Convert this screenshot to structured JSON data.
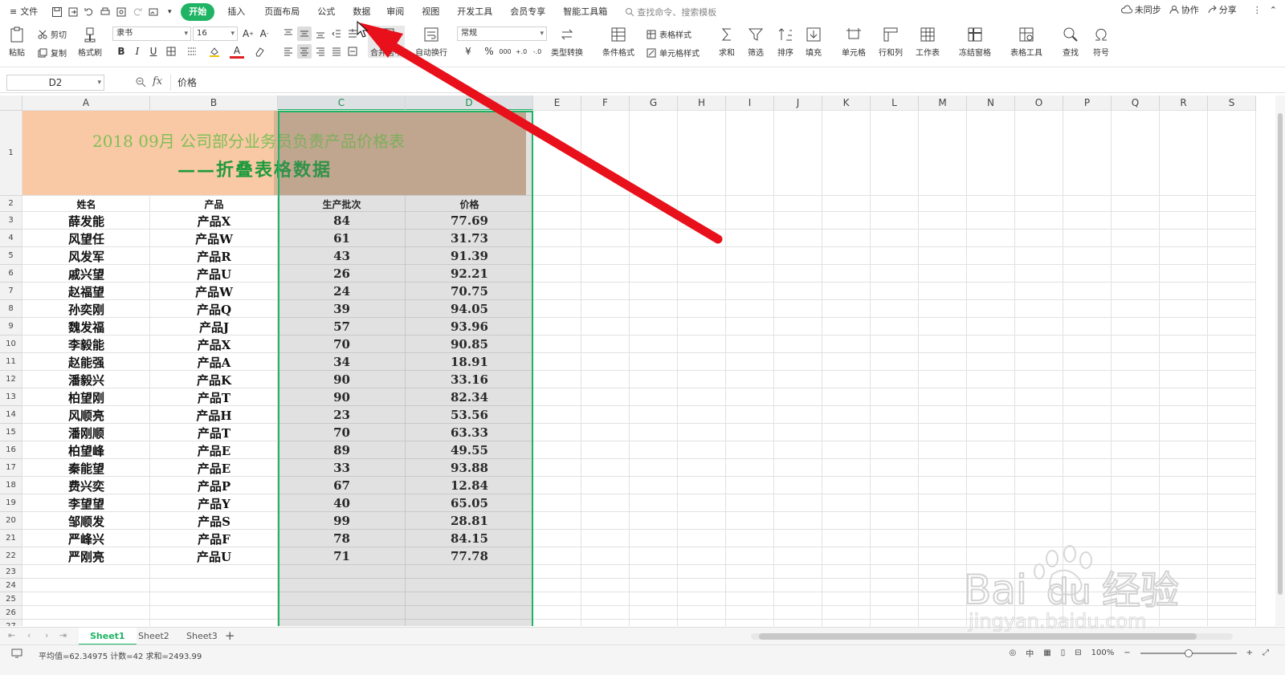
{
  "menu": {
    "file": "文件",
    "tabs": [
      "开始",
      "插入",
      "页面布局",
      "公式",
      "数据",
      "审阅",
      "视图",
      "开发工具",
      "会员专享",
      "智能工具箱"
    ],
    "active_tab": "开始",
    "search_placeholder": "查找命令、搜索模板",
    "sync": "未同步",
    "collab": "协作",
    "share": "分享"
  },
  "ribbon": {
    "paste": "粘贴",
    "cut": "剪切",
    "copy": "复制",
    "format_painter": "格式刷",
    "font_name": "隶书",
    "font_size": "16",
    "merge_center": "合并居中",
    "wrap_text": "自动换行",
    "number_format": "常规",
    "type_convert": "类型转换",
    "conditional_format": "条件格式",
    "table_style": "表格样式",
    "cell_style": "单元格样式",
    "sum": "求和",
    "filter": "筛选",
    "sort": "排序",
    "fill": "填充",
    "cell": "单元格",
    "row_col": "行和列",
    "worksheet": "工作表",
    "freeze": "冻结窗格",
    "table_tools": "表格工具",
    "find": "查找",
    "symbol": "符号"
  },
  "formula_bar": {
    "cell_ref": "D2",
    "fx": "fx",
    "content": "价格"
  },
  "grid": {
    "columns": [
      "A",
      "B",
      "C",
      "D",
      "E",
      "F",
      "G",
      "H",
      "I",
      "J",
      "K",
      "L",
      "M",
      "N",
      "O",
      "P",
      "Q",
      "R",
      "S"
    ],
    "selected_columns": [
      "C",
      "D"
    ],
    "rows": [
      "1",
      "2",
      "3",
      "4",
      "5",
      "6",
      "7",
      "8",
      "9",
      "10",
      "11",
      "12",
      "13",
      "14",
      "15",
      "16",
      "17",
      "18",
      "19",
      "20",
      "21",
      "22",
      "23",
      "24",
      "25",
      "26",
      "27"
    ],
    "title_line1": "2018 09月 公司部分业务员负责产品价格表",
    "title_line2": "——折叠表格数据",
    "headers": [
      "姓名",
      "产品",
      "生产批次",
      "价格"
    ],
    "data": [
      [
        "薛发能",
        "产品X",
        "84",
        "77.69"
      ],
      [
        "风望任",
        "产品W",
        "61",
        "31.73"
      ],
      [
        "风发军",
        "产品R",
        "43",
        "91.39"
      ],
      [
        "戚兴望",
        "产品U",
        "26",
        "92.21"
      ],
      [
        "赵福望",
        "产品W",
        "24",
        "70.75"
      ],
      [
        "孙奕刚",
        "产品Q",
        "39",
        "94.05"
      ],
      [
        "魏发福",
        "产品J",
        "57",
        "93.96"
      ],
      [
        "李毅能",
        "产品X",
        "70",
        "90.85"
      ],
      [
        "赵能强",
        "产品A",
        "34",
        "18.91"
      ],
      [
        "潘毅兴",
        "产品K",
        "90",
        "33.16"
      ],
      [
        "柏望刚",
        "产品T",
        "90",
        "82.34"
      ],
      [
        "风顺亮",
        "产品H",
        "23",
        "53.56"
      ],
      [
        "潘刚顺",
        "产品T",
        "70",
        "63.33"
      ],
      [
        "柏望峰",
        "产品E",
        "89",
        "49.55"
      ],
      [
        "秦能望",
        "产品E",
        "33",
        "93.88"
      ],
      [
        "费兴奕",
        "产品P",
        "67",
        "12.84"
      ],
      [
        "李望望",
        "产品Y",
        "40",
        "65.05"
      ],
      [
        "邹顺发",
        "产品S",
        "99",
        "28.81"
      ],
      [
        "严峰兴",
        "产品F",
        "78",
        "84.15"
      ],
      [
        "严刚亮",
        "产品U",
        "71",
        "77.78"
      ]
    ]
  },
  "sheets": {
    "tabs": [
      "Sheet1",
      "Sheet2",
      "Sheet3"
    ],
    "active": "Sheet1",
    "add": "+"
  },
  "status": {
    "summary": "平均值=62.34975  计数=42  求和=2493.99",
    "lang": "中",
    "zoom": "100%"
  },
  "watermark": {
    "brand": "Bai",
    "brand_suffix": "du",
    "cn": "经验",
    "url": "jingyan.baidu.com"
  },
  "colors": {
    "accent": "#1fb464",
    "title_bg_left": "#f9c9a5",
    "title_bg_right": "#d7b497",
    "title_line1": "#7fbf55",
    "title_line2": "#1e9a3c",
    "arrow": "#e8101a"
  }
}
